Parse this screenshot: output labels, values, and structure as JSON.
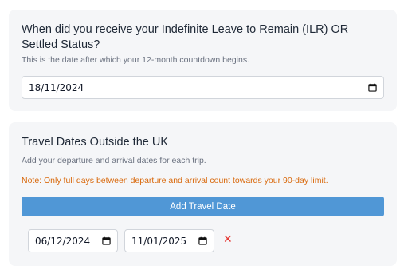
{
  "ilr_section": {
    "question": "When did you receive your Indefinite Leave to Remain (ILR) OR Settled Status?",
    "help_text": "This is the date after which your 12-month countdown begins.",
    "date_value": "18/11/2024",
    "date_icon": "calendar-icon"
  },
  "travel_section": {
    "title": "Travel Dates Outside the UK",
    "help_text": "Add your departure and arrival dates for each trip.",
    "note": "Note: Only full days between departure and arrival count towards your 90-day limit.",
    "add_button_label": "Add Travel Date",
    "trips": [
      {
        "departure": "06/12/2024",
        "arrival": "11/01/2025",
        "remove_label": "✕"
      }
    ]
  },
  "colors": {
    "card_background": "#f5f6f8",
    "primary_button": "#5097d6",
    "note_text": "#d9690c",
    "remove_icon": "#e53935"
  }
}
